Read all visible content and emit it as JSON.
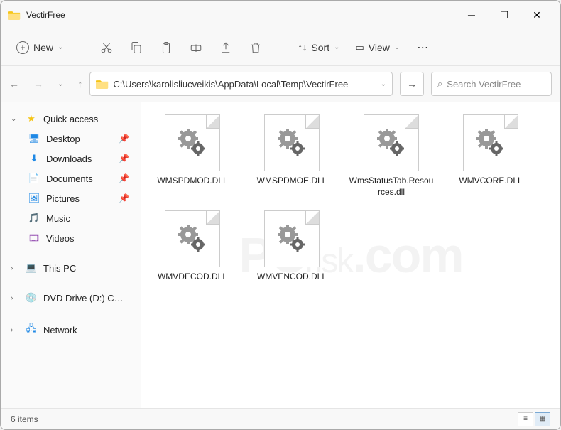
{
  "window": {
    "title": "VectirFree"
  },
  "toolbar": {
    "new_label": "New",
    "sort_label": "Sort",
    "view_label": "View"
  },
  "navbar": {
    "path": "C:\\Users\\karolisliucveikis\\AppData\\Local\\Temp\\VectirFree",
    "search_placeholder": "Search VectirFree"
  },
  "sidebar": {
    "quick_access": "Quick access",
    "desktop": "Desktop",
    "downloads": "Downloads",
    "documents": "Documents",
    "pictures": "Pictures",
    "music": "Music",
    "videos": "Videos",
    "this_pc": "This PC",
    "dvd": "DVD Drive (D:) CCCC",
    "network": "Network"
  },
  "files": [
    {
      "name": "WMSPDMOD.DLL"
    },
    {
      "name": "WMSPDMOE.DLL"
    },
    {
      "name": "WmsStatusTab.Resources.dll"
    },
    {
      "name": "WMVCORE.DLL"
    },
    {
      "name": "WMVDECOD.DLL"
    },
    {
      "name": "WMVENCOD.DLL"
    }
  ],
  "statusbar": {
    "count": "6 items"
  },
  "watermark": {
    "pc": "PC",
    "risk": "risk",
    "com": ".com"
  }
}
